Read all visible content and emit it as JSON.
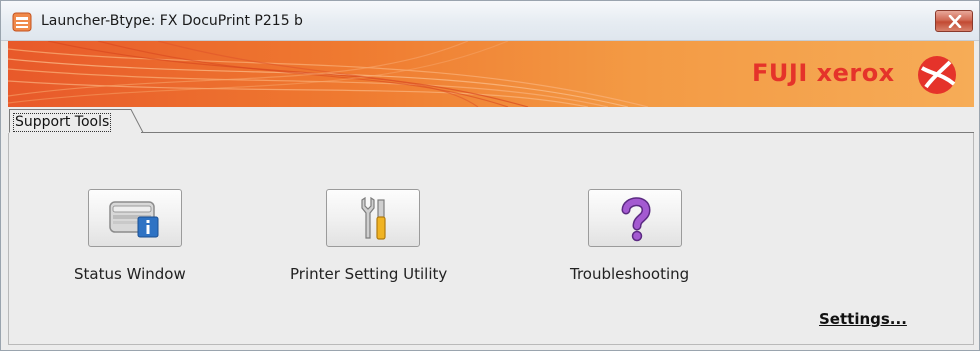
{
  "window": {
    "title": "Launcher-Btype: FX DocuPrint P215 b",
    "close_icon": "close-icon",
    "app_icon": "launcher-app-icon"
  },
  "banner": {
    "logo_text": "FUJI xerox",
    "logo_icon": "xerox-sphere-logo",
    "colors": {
      "banner_start": "#e8592a",
      "banner_end": "#f6ac57",
      "logo_red": "#e5332a"
    }
  },
  "tabs": [
    {
      "label": "Support Tools",
      "selected": true
    }
  ],
  "tools": [
    {
      "label": "Status Window",
      "icon": "printer-info-icon"
    },
    {
      "label": "Printer Setting Utility",
      "icon": "tools-icon"
    },
    {
      "label": "Troubleshooting",
      "icon": "question-mark-icon"
    }
  ],
  "settings_link": "Settings..."
}
